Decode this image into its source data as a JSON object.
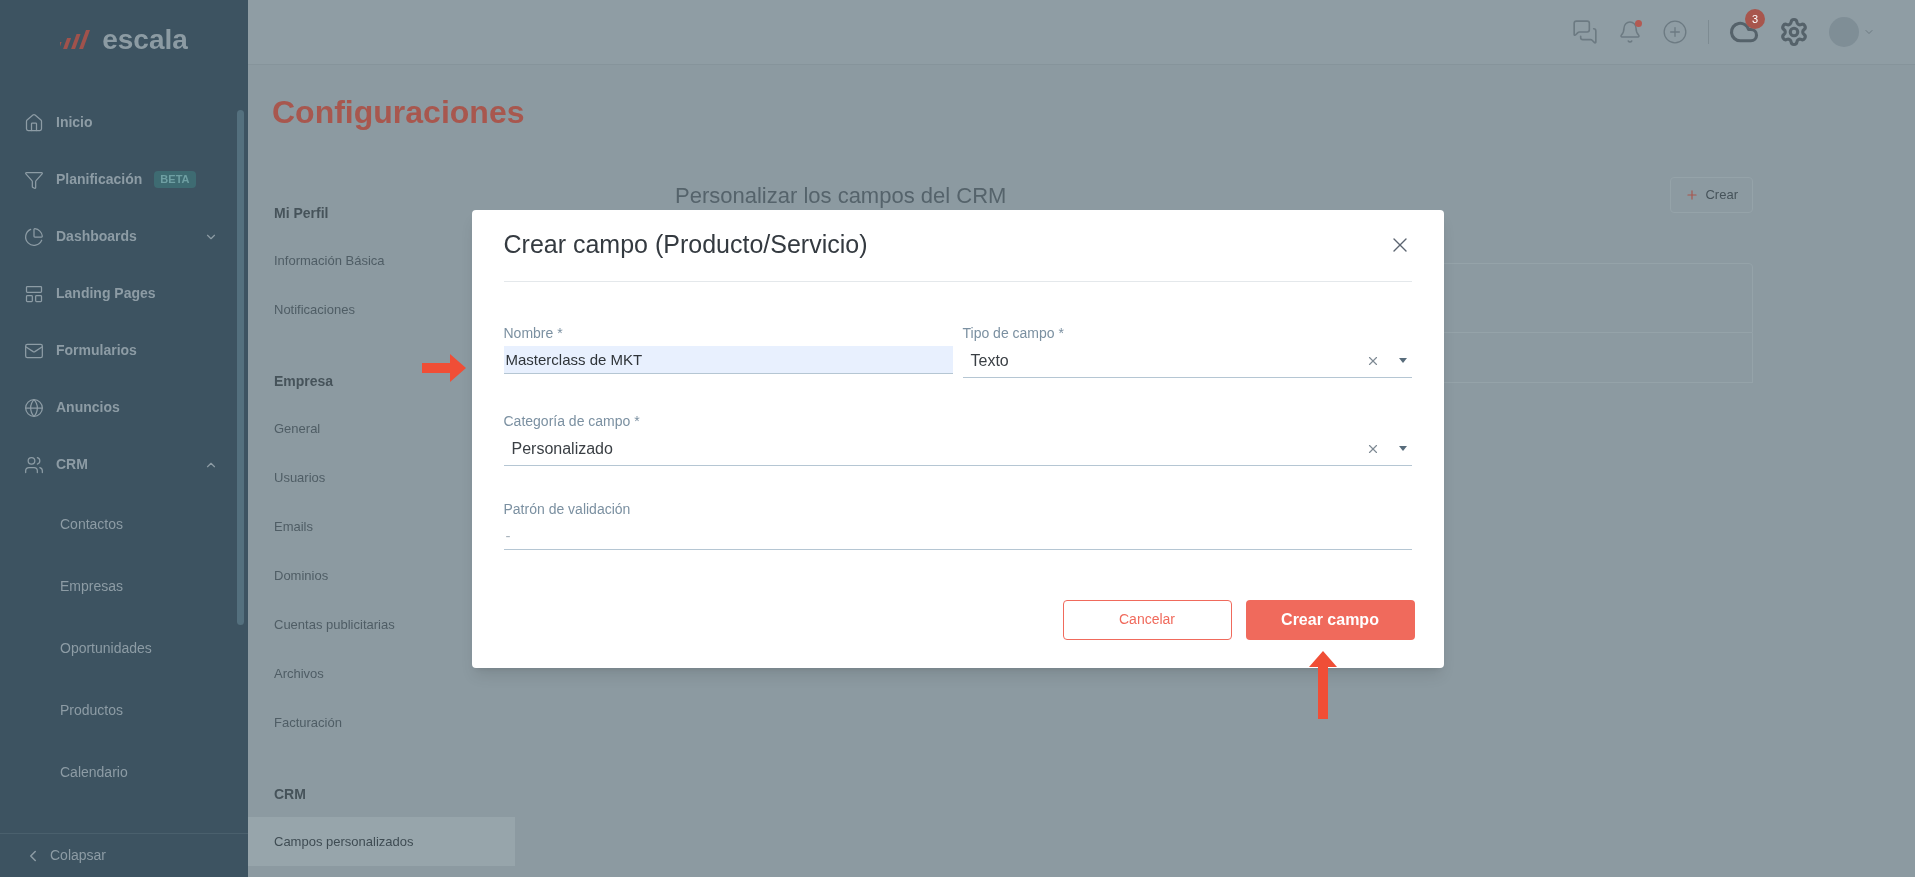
{
  "sidebar": {
    "logo": "escala",
    "items": [
      {
        "kind": "link",
        "label": "Inicio"
      },
      {
        "kind": "link",
        "label": "Planificación",
        "badge": "BETA"
      },
      {
        "kind": "group",
        "label": "Dashboards",
        "expanded": false
      },
      {
        "kind": "link",
        "label": "Landing Pages"
      },
      {
        "kind": "link",
        "label": "Formularios"
      },
      {
        "kind": "link",
        "label": "Anuncios"
      },
      {
        "kind": "group",
        "label": "CRM",
        "expanded": true,
        "children": [
          {
            "label": "Contactos"
          },
          {
            "label": "Empresas"
          },
          {
            "label": "Oportunidades"
          },
          {
            "label": "Productos"
          },
          {
            "label": "Calendario"
          }
        ]
      }
    ],
    "collapse": "Colapsar"
  },
  "topbar": {
    "bell_dot": true,
    "cloud_badge": "3"
  },
  "page": {
    "title": "Configuraciones",
    "settings_nav": [
      {
        "title": "Mi Perfil",
        "items": [
          {
            "label": "Información Básica",
            "selected": false
          },
          {
            "label": "Notificaciones",
            "selected": false
          }
        ]
      },
      {
        "title": "Empresa",
        "items": [
          {
            "label": "General",
            "selected": false
          },
          {
            "label": "Usuarios",
            "selected": false
          },
          {
            "label": "Emails",
            "selected": false
          },
          {
            "label": "Dominios",
            "selected": false
          },
          {
            "label": "Cuentas publicitarias",
            "selected": false
          },
          {
            "label": "Archivos",
            "selected": false
          },
          {
            "label": "Facturación",
            "selected": false
          }
        ]
      },
      {
        "title": "CRM",
        "items": [
          {
            "label": "Campos personalizados",
            "selected": true
          }
        ]
      }
    ],
    "content_title": "Personalizar los campos del CRM",
    "create_button": "Crear"
  },
  "modal": {
    "title": "Crear campo (Producto/Servicio)",
    "rows": [
      {
        "fields": [
          {
            "kind": "text",
            "label": "Nombre *",
            "value": "Masterclass de MKT",
            "autofilled": true
          },
          {
            "kind": "select",
            "label": "Tipo de campo *",
            "value": "Texto"
          }
        ]
      },
      {
        "fields": [
          {
            "kind": "select",
            "label": "Categoría de campo *",
            "value": "Personalizado"
          }
        ]
      },
      {
        "fields": [
          {
            "kind": "text",
            "label": "Patrón de validación",
            "placeholder": "-",
            "autofilled": false
          }
        ]
      }
    ],
    "cancel_button": "Cancelar",
    "submit_button": "Crear campo"
  }
}
